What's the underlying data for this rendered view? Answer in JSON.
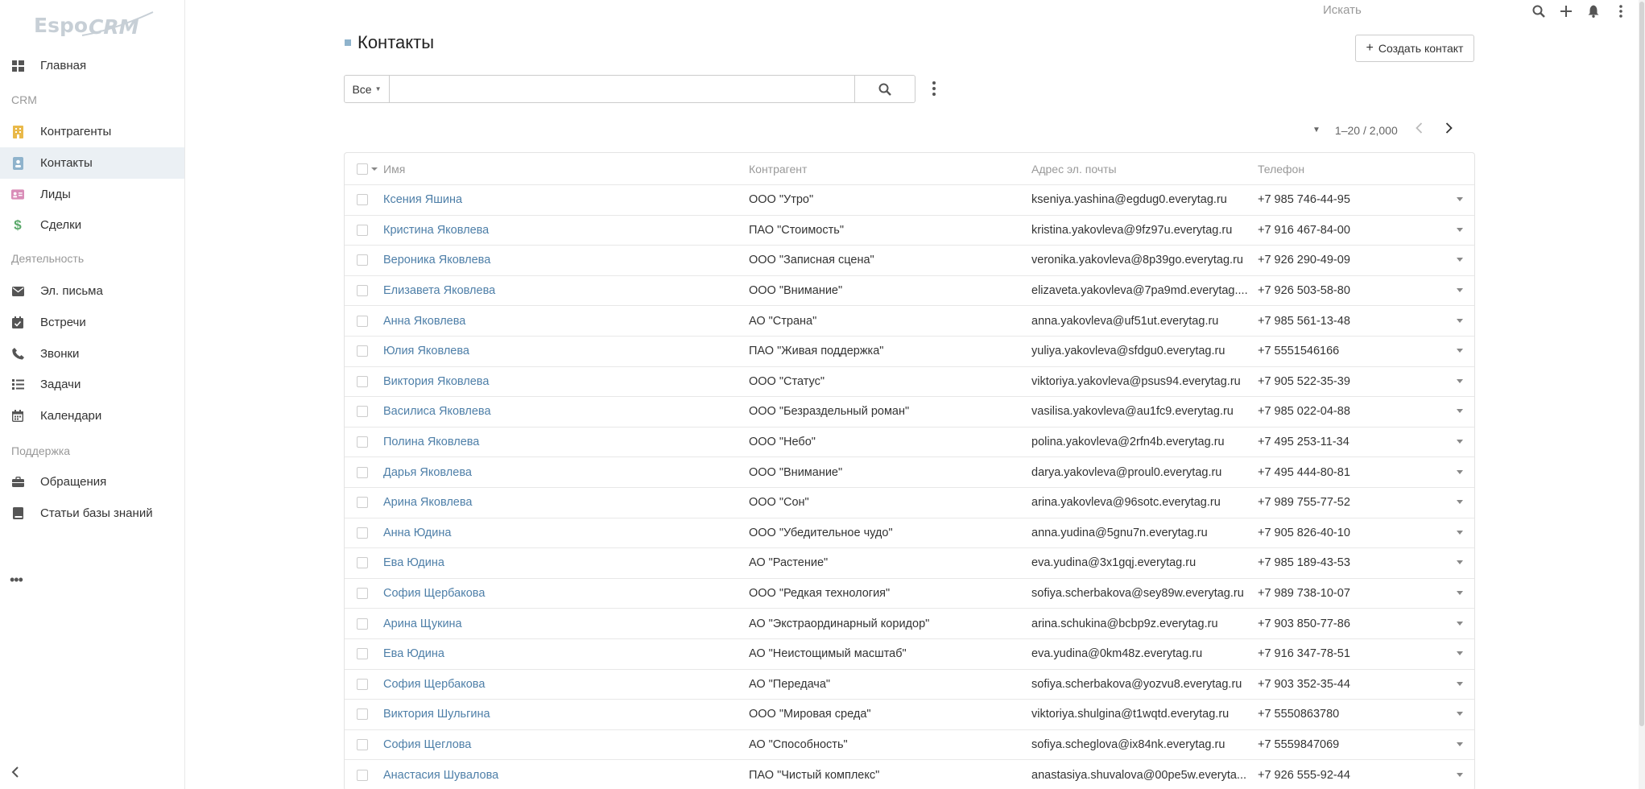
{
  "app": {
    "logo_text": "EspoCRM"
  },
  "topbar": {
    "search_placeholder": "Искать"
  },
  "sidebar": {
    "items": [
      {
        "label": "Главная",
        "icon": "grid-icon",
        "color": "#555555"
      },
      {
        "label": "Контрагенты",
        "icon": "building-icon",
        "color": "#e9b94a"
      },
      {
        "label": "Контакты",
        "icon": "contact-card-icon",
        "color": "#8fb3cc",
        "active": true
      },
      {
        "label": "Лиды",
        "icon": "id-card-icon",
        "color": "#d98db8"
      },
      {
        "label": "Сделки",
        "icon": "dollar-icon",
        "color": "#5aa86a"
      },
      {
        "label": "Эл. письма",
        "icon": "envelope-icon",
        "color": "#555555"
      },
      {
        "label": "Встречи",
        "icon": "calendar-check-icon",
        "color": "#555555"
      },
      {
        "label": "Звонки",
        "icon": "phone-icon",
        "color": "#555555"
      },
      {
        "label": "Задачи",
        "icon": "tasks-icon",
        "color": "#555555"
      },
      {
        "label": "Календари",
        "icon": "calendar-icon",
        "color": "#555555"
      },
      {
        "label": "Обращения",
        "icon": "briefcase-icon",
        "color": "#555555"
      },
      {
        "label": "Статьи базы знаний",
        "icon": "book-icon",
        "color": "#555555"
      }
    ],
    "groups": [
      "CRM",
      "Деятельность",
      "Поддержка"
    ]
  },
  "page": {
    "title": "Контакты",
    "create_label": "Создать контакт",
    "filter_select": "Все",
    "search_value": "",
    "pager_range": "1–20 / 2,000"
  },
  "table": {
    "headers": {
      "name": "Имя",
      "account": "Контрагент",
      "email": "Адрес эл. почты",
      "phone": "Телефон"
    },
    "rows": [
      {
        "name": "Ксения Яшина",
        "account": "ООО \"Утро\"",
        "email": "kseniya.yashina@egdug0.everytag.ru",
        "phone": "+7 985 746-44-95"
      },
      {
        "name": "Кристина Яковлева",
        "account": "ПАО \"Стоимость\"",
        "email": "kristina.yakovleva@9fz97u.everytag.ru",
        "phone": "+7 916 467-84-00"
      },
      {
        "name": "Вероника Яковлева",
        "account": "ООО \"Записная сцена\"",
        "email": "veronika.yakovleva@8p39go.everytag.ru",
        "phone": "+7 926 290-49-09"
      },
      {
        "name": "Елизавета Яковлева",
        "account": "ООО \"Внимание\"",
        "email": "elizaveta.yakovleva@7pa9md.everytag....",
        "phone": "+7 926 503-58-80"
      },
      {
        "name": "Анна Яковлева",
        "account": "АО \"Страна\"",
        "email": "anna.yakovleva@uf51ut.everytag.ru",
        "phone": "+7 985 561-13-48"
      },
      {
        "name": "Юлия Яковлева",
        "account": "ПАО \"Живая поддержка\"",
        "email": "yuliya.yakovleva@sfdgu0.everytag.ru",
        "phone": "+7 5551546166"
      },
      {
        "name": "Виктория Яковлева",
        "account": "ООО \"Статус\"",
        "email": "viktoriya.yakovleva@psus94.everytag.ru",
        "phone": "+7 905 522-35-39"
      },
      {
        "name": "Василиса Яковлева",
        "account": "ООО \"Безраздельный роман\"",
        "email": "vasilisa.yakovleva@au1fc9.everytag.ru",
        "phone": "+7 985 022-04-88"
      },
      {
        "name": "Полина Яковлева",
        "account": "ООО \"Небо\"",
        "email": "polina.yakovleva@2rfn4b.everytag.ru",
        "phone": "+7 495 253-11-34"
      },
      {
        "name": "Дарья Яковлева",
        "account": "ООО \"Внимание\"",
        "email": "darya.yakovleva@proul0.everytag.ru",
        "phone": "+7 495 444-80-81"
      },
      {
        "name": "Арина Яковлева",
        "account": "ООО \"Сон\"",
        "email": "arina.yakovleva@96sotc.everytag.ru",
        "phone": "+7 989 755-77-52"
      },
      {
        "name": "Анна Юдина",
        "account": "ООО \"Убедительное чудо\"",
        "email": "anna.yudina@5gnu7n.everytag.ru",
        "phone": "+7 905 826-40-10"
      },
      {
        "name": "Ева Юдина",
        "account": "АО \"Растение\"",
        "email": "eva.yudina@3x1gqj.everytag.ru",
        "phone": "+7 985 189-43-53"
      },
      {
        "name": "София Щербакова",
        "account": "ООО \"Редкая технология\"",
        "email": "sofiya.scherbakova@sey89w.everytag.ru",
        "phone": "+7 989 738-10-07"
      },
      {
        "name": "Арина Щукина",
        "account": "АО \"Экстраординарный коридор\"",
        "email": "arina.schukina@bcbp9z.everytag.ru",
        "phone": "+7 903 850-77-86"
      },
      {
        "name": "Ева Юдина",
        "account": "АО \"Неистощимый масштаб\"",
        "email": "eva.yudina@0km48z.everytag.ru",
        "phone": "+7 916 347-78-51"
      },
      {
        "name": "София Щербакова",
        "account": "АО \"Передача\"",
        "email": "sofiya.scherbakova@yozvu8.everytag.ru",
        "phone": "+7 903 352-35-44"
      },
      {
        "name": "Виктория Шульгина",
        "account": "ООО \"Мировая среда\"",
        "email": "viktoriya.shulgina@t1wqtd.everytag.ru",
        "phone": "+7 5550863780"
      },
      {
        "name": "София Щеглова",
        "account": "АО \"Способность\"",
        "email": "sofiya.scheglova@ix84nk.everytag.ru",
        "phone": "+7 5559847069"
      },
      {
        "name": "Анастасия Шувалова",
        "account": "ПАО \"Чистый комплекс\"",
        "email": "anastasiya.shuvalova@00pe5w.everyta...",
        "phone": "+7 926 555-92-44"
      }
    ]
  }
}
